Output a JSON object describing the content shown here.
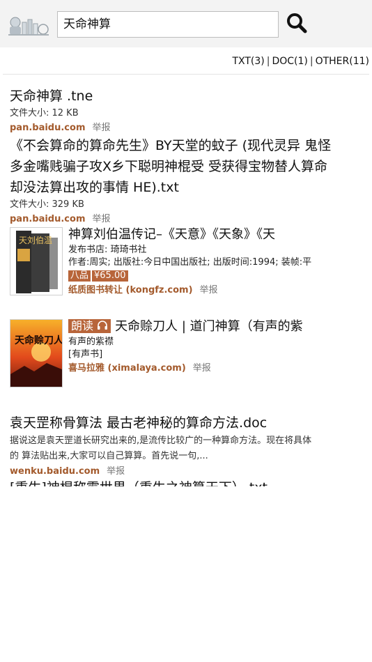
{
  "search": {
    "query": "天命神算"
  },
  "filters": {
    "txt": "TXT(3)",
    "doc": "DOC(1)",
    "other": "OTHER(11)",
    "separator": "|"
  },
  "results": [
    {
      "title": "天命神算 .tne",
      "size": "文件大小: 12 KB",
      "host": "pan.baidu.com",
      "report": "举报"
    },
    {
      "title_line1": "《不会算命的算命先生》BY天堂的蚊子 (现代灵异 鬼怪",
      "title_line2": "多金嘴贱骗子攻X乡下聪明神棍受 受获得宝物替人算命",
      "title_line3": "却没法算出攻的事情 HE).txt",
      "size": "文件大小: 329 KB",
      "host": "pan.baidu.com",
      "report": "举报"
    }
  ],
  "book1": {
    "title": "神算刘伯温传记–《天意》《天象》《天",
    "publisher": "发布书店: 琦琦书社",
    "info": "作者:周实; 出版社:今日中国出版社; 出版时间:1994; 装帧:平",
    "condition": "八品",
    "price": "¥65.00",
    "host": "纸质图书转让 (kongfz.com)",
    "report": "举报",
    "cover_text": "天刘伯温"
  },
  "book2": {
    "badge": "朗读",
    "title": "天命赊刀人 | 道门神算（有声的紫",
    "author": "有声的紫襟",
    "type": "[有声书]",
    "host": "喜马拉雅 (ximalaya.com)",
    "report": "举报",
    "cover_text": "天命赊刀人"
  },
  "result3": {
    "title": "袁天罡称骨算法 最古老神秘的算命方法.doc",
    "snippet_line1": "据说这是袁天罡道长研究出来的,是流传比较广的一种算命方法。现在将具体",
    "snippet_line2": "的 算法贴出来,大家可以自己算算。首先说一句,...",
    "host": "wenku.baidu.com",
    "report": "举报"
  },
  "result4": {
    "title": "[重生]神棍称霸世界（重生之神算天下）.txt"
  },
  "colors": {
    "accent": "#b8653a",
    "host": "#a35a2c",
    "header_bg": "#f3f3f3"
  }
}
